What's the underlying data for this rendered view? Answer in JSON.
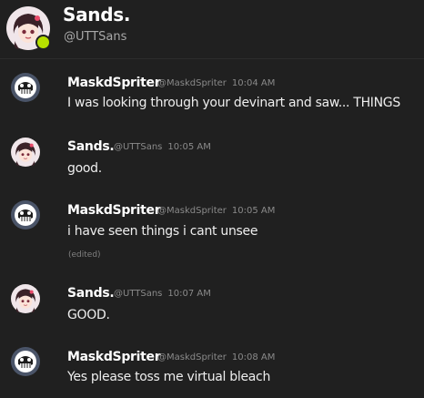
{
  "header": {
    "name": "Sands.",
    "handle": "@UTTSans",
    "status_color": "#b7e000"
  },
  "messages": [
    {
      "author": "MaskdSpriter",
      "handle": "@MaskdSpriter",
      "time": "10:04 AM",
      "text": "I was looking through your devinart and saw... THINGS",
      "avatar": "skull-avatar"
    },
    {
      "author": "Sands.",
      "handle": "@UTTSans",
      "time": "10:05 AM",
      "text": "good.",
      "avatar": "anime-girl-avatar"
    },
    {
      "author": "MaskdSpriter",
      "handle": "@MaskdSpriter",
      "time": "10:05 AM",
      "text": "i have seen things i cant unsee",
      "edited": "(edited)",
      "avatar": "skull-avatar"
    },
    {
      "author": "Sands.",
      "handle": "@UTTSans",
      "time": "10:07 AM",
      "text": "GOOD.",
      "avatar": "anime-girl-avatar"
    },
    {
      "author": "MaskdSpriter",
      "handle": "@MaskdSpriter",
      "time": "10:08 AM",
      "text": "Yes please toss me virtual bleach",
      "avatar": "skull-avatar"
    }
  ]
}
